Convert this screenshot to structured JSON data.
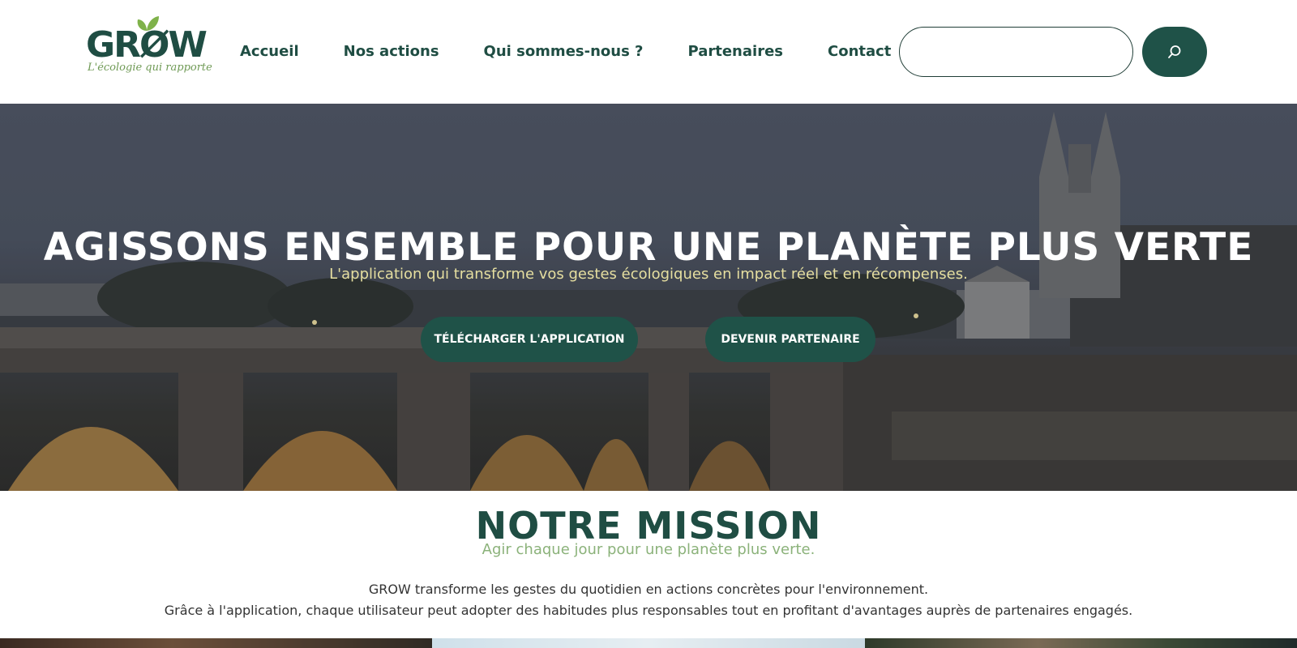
{
  "header": {
    "logo": {
      "name": "GRØW",
      "tagline": "L'écologie qui rapporte"
    },
    "nav": [
      {
        "label": "Accueil"
      },
      {
        "label": "Nos actions"
      },
      {
        "label": "Qui sommes-nous ?"
      },
      {
        "label": "Partenaires"
      },
      {
        "label": "Contact"
      }
    ],
    "search": {
      "placeholder": "",
      "value": "",
      "button_icon": "search-icon"
    }
  },
  "hero": {
    "title": "AGISSONS ENSEMBLE POUR UNE PLANÈTE PLUS VERTE",
    "subtitle": "L'application qui transforme vos gestes écologiques en impact réel et en récompenses.",
    "buttons": {
      "download": "TÉLÉCHARGER L'APPLICATION",
      "partner": "DEVENIR PARTENAIRE"
    }
  },
  "mission": {
    "title": "NOTRE MISSION",
    "subtitle": "Agir chaque jour pour une planète plus verte.",
    "text_line1": "GROW transforme les gestes du quotidien en actions concrètes pour l'environnement.",
    "text_line2": "Grâce à l'application, chaque utilisateur peut adopter des habitudes plus responsables tout en profitant d'avantages auprès de partenaires engagés."
  },
  "colors": {
    "primary": "#1f5248",
    "heading": "#1f4d43",
    "accent_green": "#8bb27a",
    "hero_subtitle": "#e6dfa0"
  }
}
